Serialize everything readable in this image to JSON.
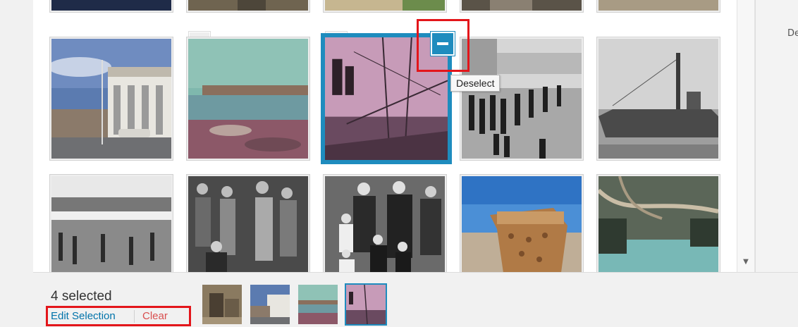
{
  "sidebar": {
    "text": "De"
  },
  "tooltip": {
    "deselect": "Deselect"
  },
  "selection": {
    "count_label": "4 selected",
    "edit_label": "Edit Selection",
    "clear_label": "Clear"
  },
  "icons": {
    "check": "check-icon",
    "deselect": "minus-icon",
    "scroll_down": "arrow-down-icon"
  },
  "colors": {
    "accent": "#1e8cbe",
    "annotation": "#e3151a",
    "link": "#0073aa",
    "danger": "#d94f4f"
  }
}
